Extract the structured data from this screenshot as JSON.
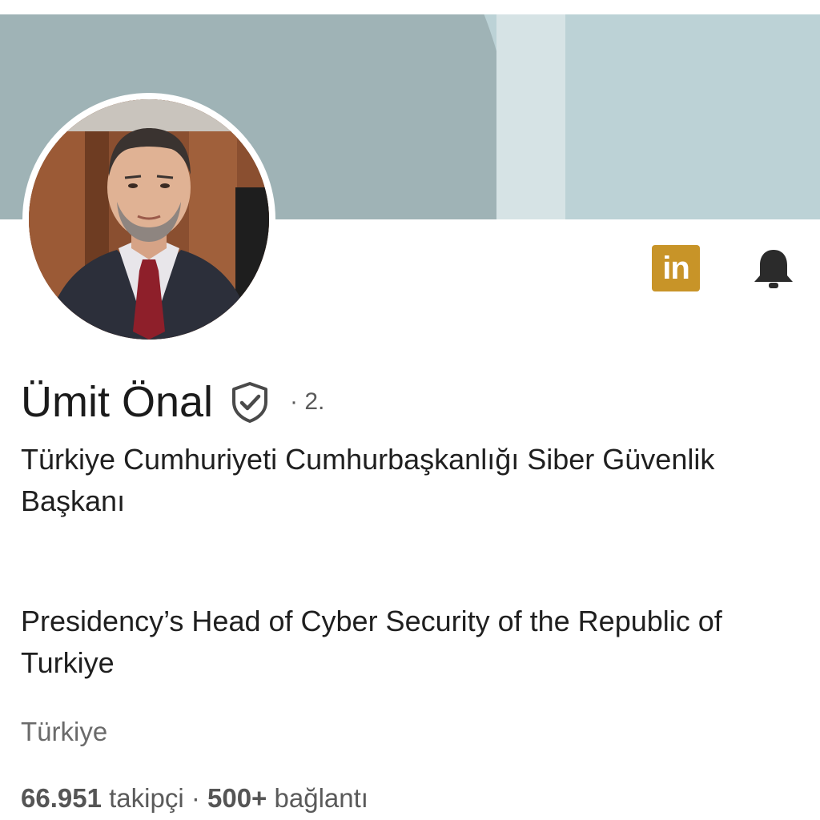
{
  "profile": {
    "name": "Ümit Önal",
    "connection_degree": "· 2.",
    "headline": "Türkiye Cumhuriyeti Cumhurbaşkanlığı Siber Güvenlik Başkanı",
    "about": "Presidency’s Head of Cyber Security of the Republic of Turkiye",
    "location": "Türkiye",
    "followers_count": "66.951",
    "followers_label": "takipçi",
    "stats_separator": "·",
    "connections_count": "500+",
    "connections_label": "bağlantı"
  },
  "icons": {
    "linkedin_badge": "in",
    "verified": "verified-shield-icon",
    "notifications": "bell-icon"
  },
  "colors": {
    "linkedin_badge_bg": "#c89428",
    "banner_dark": "#9fb3b6",
    "banner_light": "#bcd2d6"
  }
}
